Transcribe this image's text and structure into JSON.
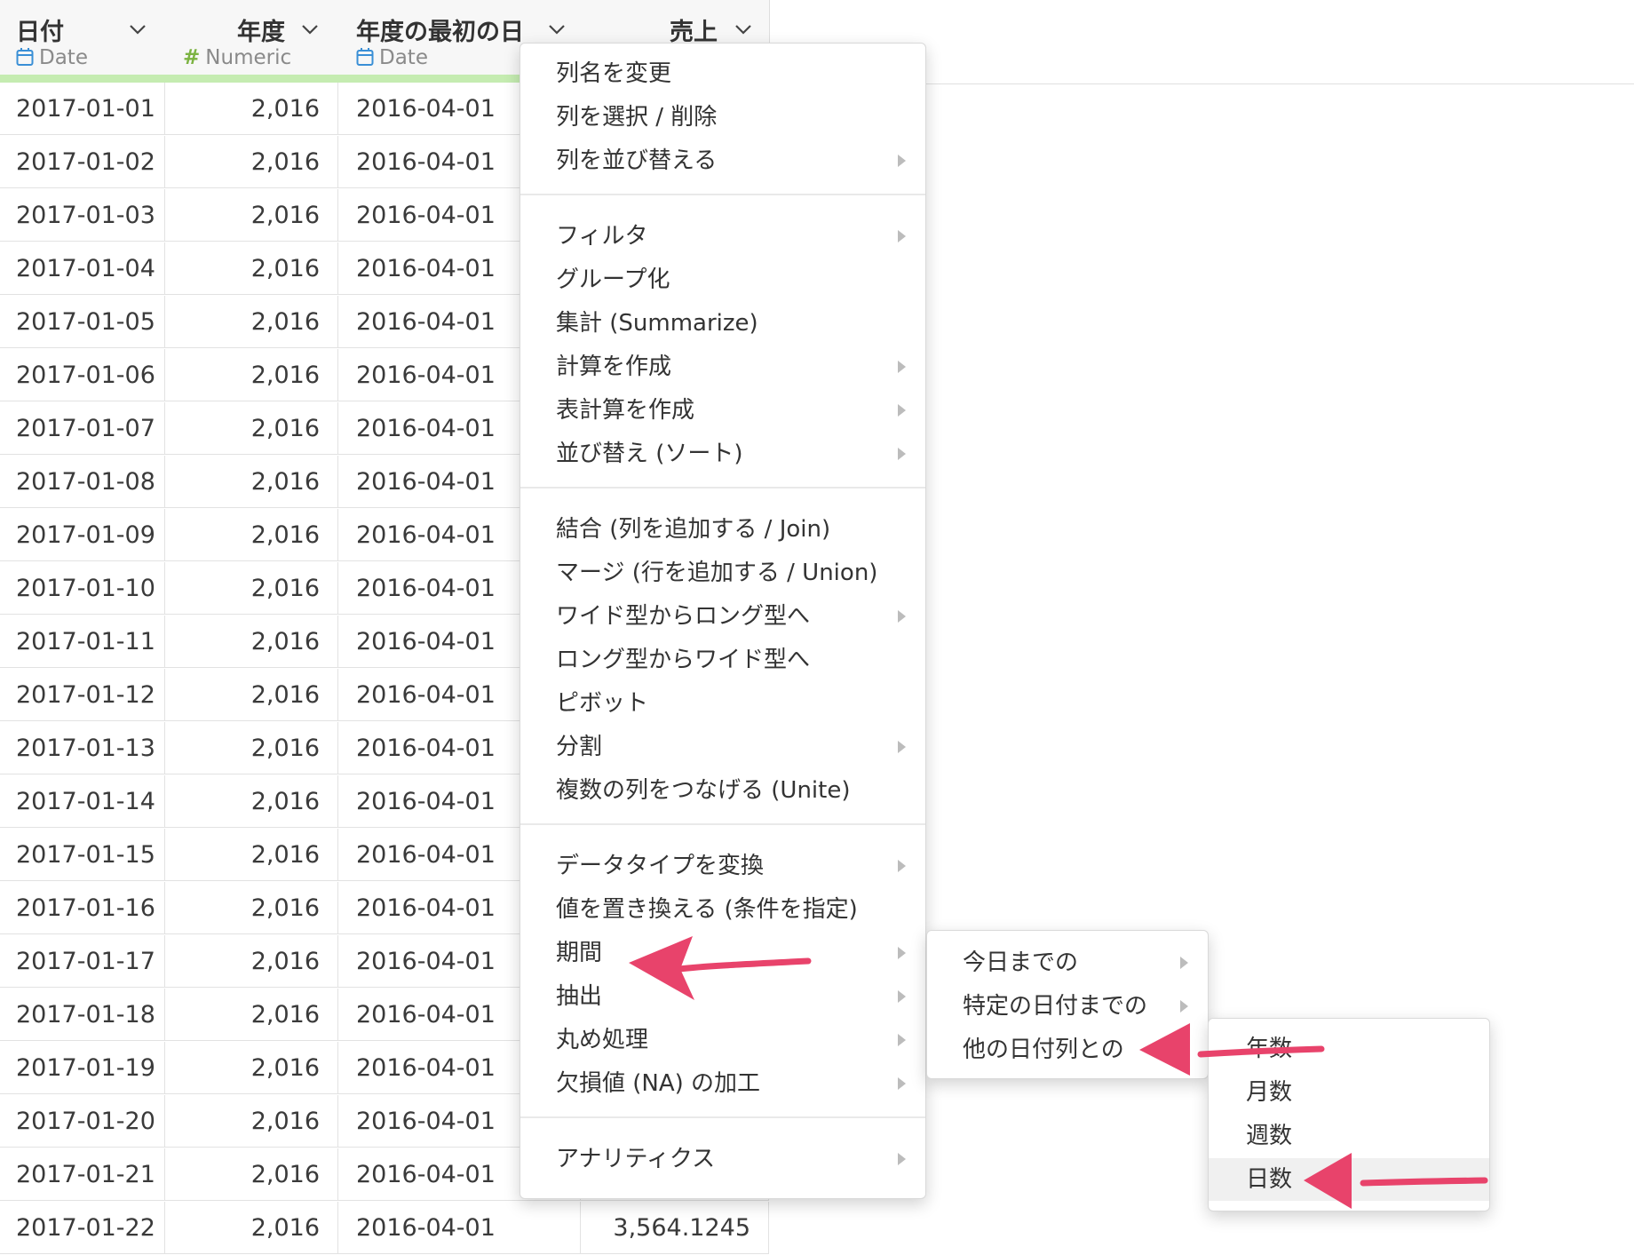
{
  "columns": [
    {
      "name": "日付",
      "type": "Date",
      "type_icon": "calendar-icon"
    },
    {
      "name": "年度",
      "type": "Numeric",
      "type_icon": "hash-icon"
    },
    {
      "name": "年度の最初の日",
      "type": "Date",
      "type_icon": "calendar-icon"
    },
    {
      "name": "売上",
      "type": "",
      "type_icon": ""
    }
  ],
  "rows": [
    [
      "2017-01-01",
      "2,016",
      "2016-04-01",
      ""
    ],
    [
      "2017-01-02",
      "2,016",
      "2016-04-01",
      ""
    ],
    [
      "2017-01-03",
      "2,016",
      "2016-04-01",
      ""
    ],
    [
      "2017-01-04",
      "2,016",
      "2016-04-01",
      ""
    ],
    [
      "2017-01-05",
      "2,016",
      "2016-04-01",
      ""
    ],
    [
      "2017-01-06",
      "2,016",
      "2016-04-01",
      ""
    ],
    [
      "2017-01-07",
      "2,016",
      "2016-04-01",
      ""
    ],
    [
      "2017-01-08",
      "2,016",
      "2016-04-01",
      ""
    ],
    [
      "2017-01-09",
      "2,016",
      "2016-04-01",
      ""
    ],
    [
      "2017-01-10",
      "2,016",
      "2016-04-01",
      ""
    ],
    [
      "2017-01-11",
      "2,016",
      "2016-04-01",
      ""
    ],
    [
      "2017-01-12",
      "2,016",
      "2016-04-01",
      ""
    ],
    [
      "2017-01-13",
      "2,016",
      "2016-04-01",
      ""
    ],
    [
      "2017-01-14",
      "2,016",
      "2016-04-01",
      ""
    ],
    [
      "2017-01-15",
      "2,016",
      "2016-04-01",
      ""
    ],
    [
      "2017-01-16",
      "2,016",
      "2016-04-01",
      ""
    ],
    [
      "2017-01-17",
      "2,016",
      "2016-04-01",
      ""
    ],
    [
      "2017-01-18",
      "2,016",
      "2016-04-01",
      ""
    ],
    [
      "2017-01-19",
      "2,016",
      "2016-04-01",
      ""
    ],
    [
      "2017-01-20",
      "2,016",
      "2016-04-01",
      ""
    ],
    [
      "2017-01-21",
      "2,016",
      "2016-04-01",
      ""
    ],
    [
      "2017-01-22",
      "2,016",
      "2016-04-01",
      "3,564.1245"
    ]
  ],
  "context_menu": {
    "groups": [
      [
        {
          "label": "列名を変更",
          "submenu": false
        },
        {
          "label": "列を選択 / 削除",
          "submenu": false
        },
        {
          "label": "列を並び替える",
          "submenu": true
        }
      ],
      [
        {
          "label": "フィルタ",
          "submenu": true
        },
        {
          "label": "グループ化",
          "submenu": false
        },
        {
          "label": "集計 (Summarize)",
          "submenu": false
        },
        {
          "label": "計算を作成",
          "submenu": true
        },
        {
          "label": "表計算を作成",
          "submenu": true
        },
        {
          "label": "並び替え (ソート)",
          "submenu": true
        }
      ],
      [
        {
          "label": "結合 (列を追加する / Join)",
          "submenu": false
        },
        {
          "label": "マージ (行を追加する / Union)",
          "submenu": false
        },
        {
          "label": "ワイド型からロング型へ",
          "submenu": true
        },
        {
          "label": "ロング型からワイド型へ",
          "submenu": false
        },
        {
          "label": "ピボット",
          "submenu": false
        },
        {
          "label": "分割",
          "submenu": true
        },
        {
          "label": "複数の列をつなげる (Unite)",
          "submenu": false
        }
      ],
      [
        {
          "label": "データタイプを変換",
          "submenu": true
        },
        {
          "label": "値を置き換える (条件を指定)",
          "submenu": false
        },
        {
          "label": "期間",
          "submenu": true
        },
        {
          "label": "抽出",
          "submenu": true
        },
        {
          "label": "丸め処理",
          "submenu": true
        },
        {
          "label": "欠損値 (NA) の加工",
          "submenu": true
        }
      ],
      [
        {
          "label": "アナリティクス",
          "submenu": true
        }
      ]
    ]
  },
  "period_submenu": [
    {
      "label": "今日までの",
      "submenu": true
    },
    {
      "label": "特定の日付までの",
      "submenu": true
    },
    {
      "label": "他の日付列との",
      "submenu": true
    }
  ],
  "units_submenu": [
    {
      "label": "年数"
    },
    {
      "label": "月数"
    },
    {
      "label": "週数"
    },
    {
      "label": "日数"
    }
  ],
  "colors": {
    "annotation_arrow": "#e8436b",
    "numeric_icon": "#7cb342",
    "date_icon": "#3a8fd6",
    "selected_column_accent": "#f5a623",
    "header_status_bar": "#c5ecb1"
  }
}
